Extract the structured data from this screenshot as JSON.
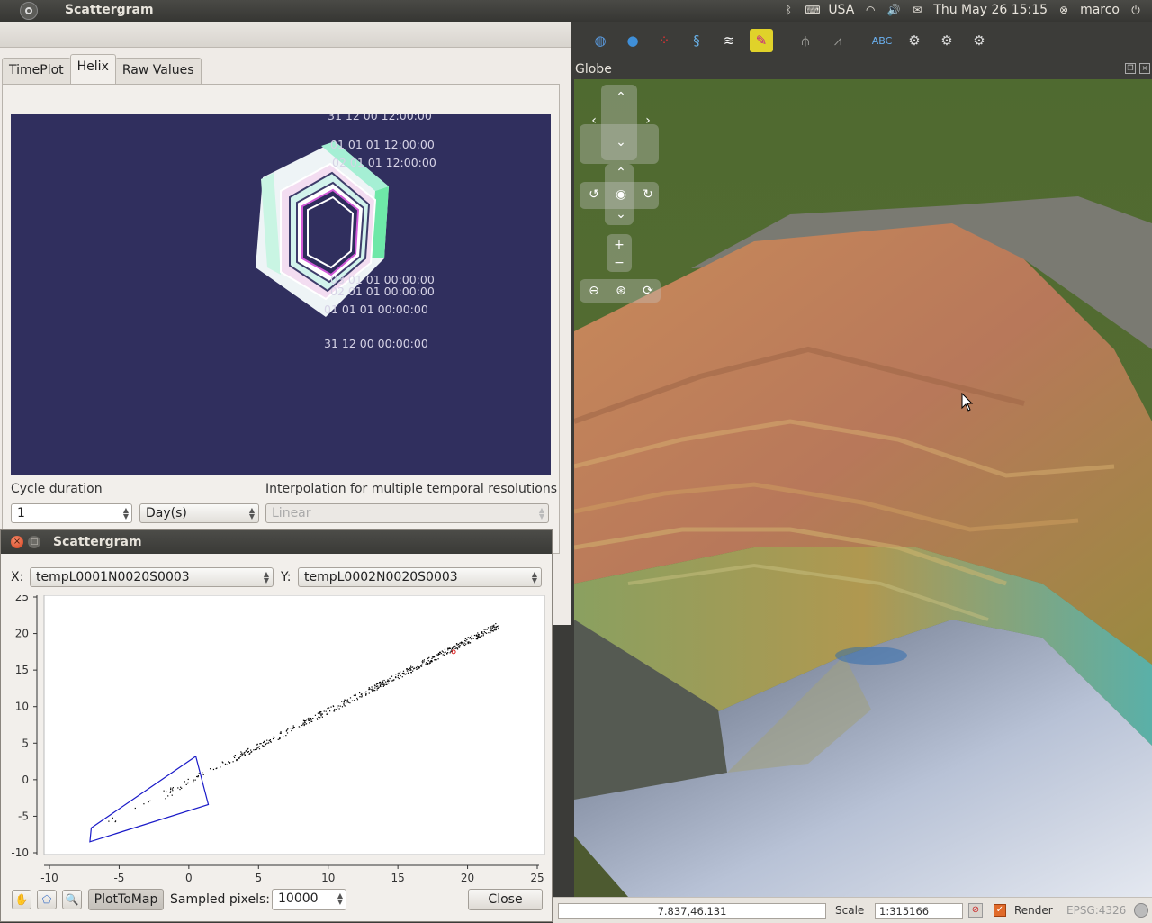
{
  "topbar": {
    "app_title": "Scattergram",
    "keyboard": "USA",
    "datetime": "Thu May 26 15:15",
    "user": "marco"
  },
  "tabs": [
    "TimePlot",
    "Helix",
    "Raw Values"
  ],
  "active_tab": "Helix",
  "helix": {
    "labels": [
      "31 12 00 12:00:00",
      "01 01 01 12:00:00",
      "02 01 01 12:00:00",
      "03 01 01 00:00:00",
      "02 01 01 00:00:00",
      "01 01 01 00:00:00",
      "31 12 00 00:00:00"
    ],
    "cycle_label": "Cycle duration",
    "cycle_value": "1",
    "cycle_unit": "Day(s)",
    "interp_label": "Interpolation for multiple temporal resolutions",
    "interp_value": "Linear"
  },
  "globe": {
    "title": "Globe"
  },
  "statusbar": {
    "coordinate": "7.837,46.131",
    "scale_label": "Scale",
    "scale_value": "1:315166",
    "render_label": "Render",
    "crs": "EPSG:4326"
  },
  "scattergram": {
    "title": "Scattergram",
    "x_label": "X:",
    "x_value": "tempL0001N0020S0003",
    "y_label": "Y:",
    "y_value": "tempL0002N0020S0003",
    "plot_to_map": "PlotToMap",
    "sampled_label": "Sampled pixels:",
    "sampled_value": "10000",
    "close": "Close"
  },
  "chart_data": {
    "type": "scatter",
    "xlim": [
      -10,
      25
    ],
    "ylim": [
      -10,
      25
    ],
    "xticks": [
      "-10",
      "-5",
      "0",
      "5",
      "10",
      "15",
      "20",
      "25"
    ],
    "yticks": [
      "-10",
      "-5",
      "0",
      "5",
      "10",
      "15",
      "20",
      "25"
    ],
    "trend": {
      "x_start": -3,
      "y_start": -3,
      "x_end": 22.3,
      "y_end": 21.3
    },
    "selection_polygon": [
      [
        -7,
        -6.6
      ],
      [
        0.5,
        3.2
      ],
      [
        1.4,
        -3.4
      ],
      [
        -7.1,
        -8.5
      ]
    ],
    "highlight_point": [
      19,
      17.5
    ],
    "grid": false
  }
}
